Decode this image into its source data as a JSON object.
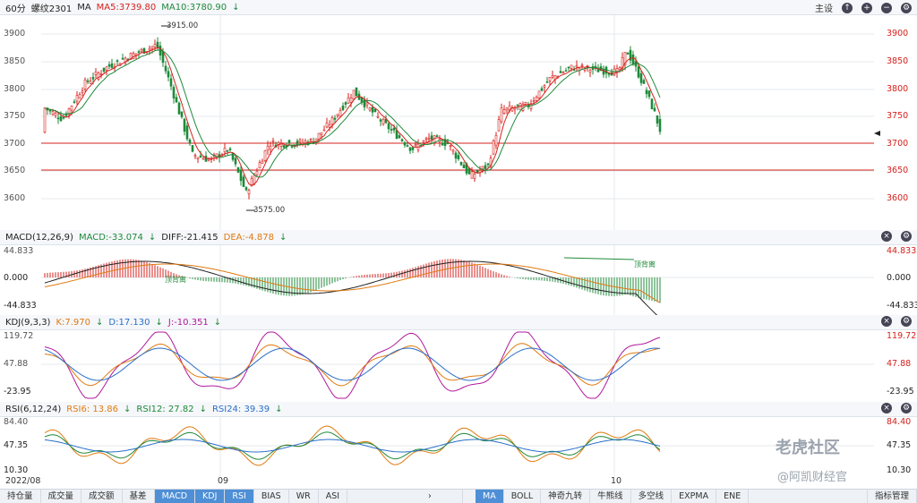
{
  "main_header": {
    "period": "60分",
    "symbol": "螺纹2301",
    "indicator": "MA",
    "ma5": "MA5:3739.80",
    "ma10": "MA10:3780.90",
    "settings_label": "主设"
  },
  "price_axis": {
    "ticks": [
      "3900",
      "3850",
      "3800",
      "3750",
      "3700",
      "3650",
      "3600"
    ],
    "high_label": "3915.00",
    "low_label": "3575.00"
  },
  "macd_header": {
    "name": "MACD(12,26,9)",
    "macd": "MACD:-33.074",
    "diff": "DIFF:-21.415",
    "dea": "DEA:-4.878"
  },
  "macd_axis": {
    "ticks": [
      "44.833",
      "0.000",
      "-44.833"
    ],
    "annotations": [
      "顶背离",
      "顶背离"
    ]
  },
  "kdj_header": {
    "name": "KDJ(9,3,3)",
    "k": "K:7.970",
    "d": "D:17.130",
    "j": "J:-10.351"
  },
  "kdj_axis": {
    "ticks": [
      "119.72",
      "47.88",
      "-23.95"
    ]
  },
  "rsi_header": {
    "name": "RSI(6,12,24)",
    "rsi6": "RSI6: 13.86",
    "rsi12": "RSI12: 27.82",
    "rsi24": "RSI24: 39.39"
  },
  "rsi_axis": {
    "ticks": [
      "84.40",
      "47.35",
      "10.30"
    ]
  },
  "time_axis": [
    "2022/08",
    "09",
    "10"
  ],
  "bottom_tabs_left": [
    "持仓量",
    "成交量",
    "成交额",
    "基差",
    "MACD",
    "KDJ",
    "RSI",
    "BIAS",
    "WR",
    "ASI"
  ],
  "bottom_tabs_right": [
    "MA",
    "BOLL",
    "神奇九转",
    "牛熊线",
    "多空线",
    "EXPMA",
    "ENE"
  ],
  "bottom_right_button": "指标管理",
  "watermark": {
    "line1": "老虎社区",
    "line2": "@阿凯财经官"
  },
  "colors": {
    "red": "#d6211c",
    "green": "#1f8a3a",
    "orange": "#e07a10",
    "magenta": "#b0199c",
    "blue": "#2a6fc9"
  }
}
